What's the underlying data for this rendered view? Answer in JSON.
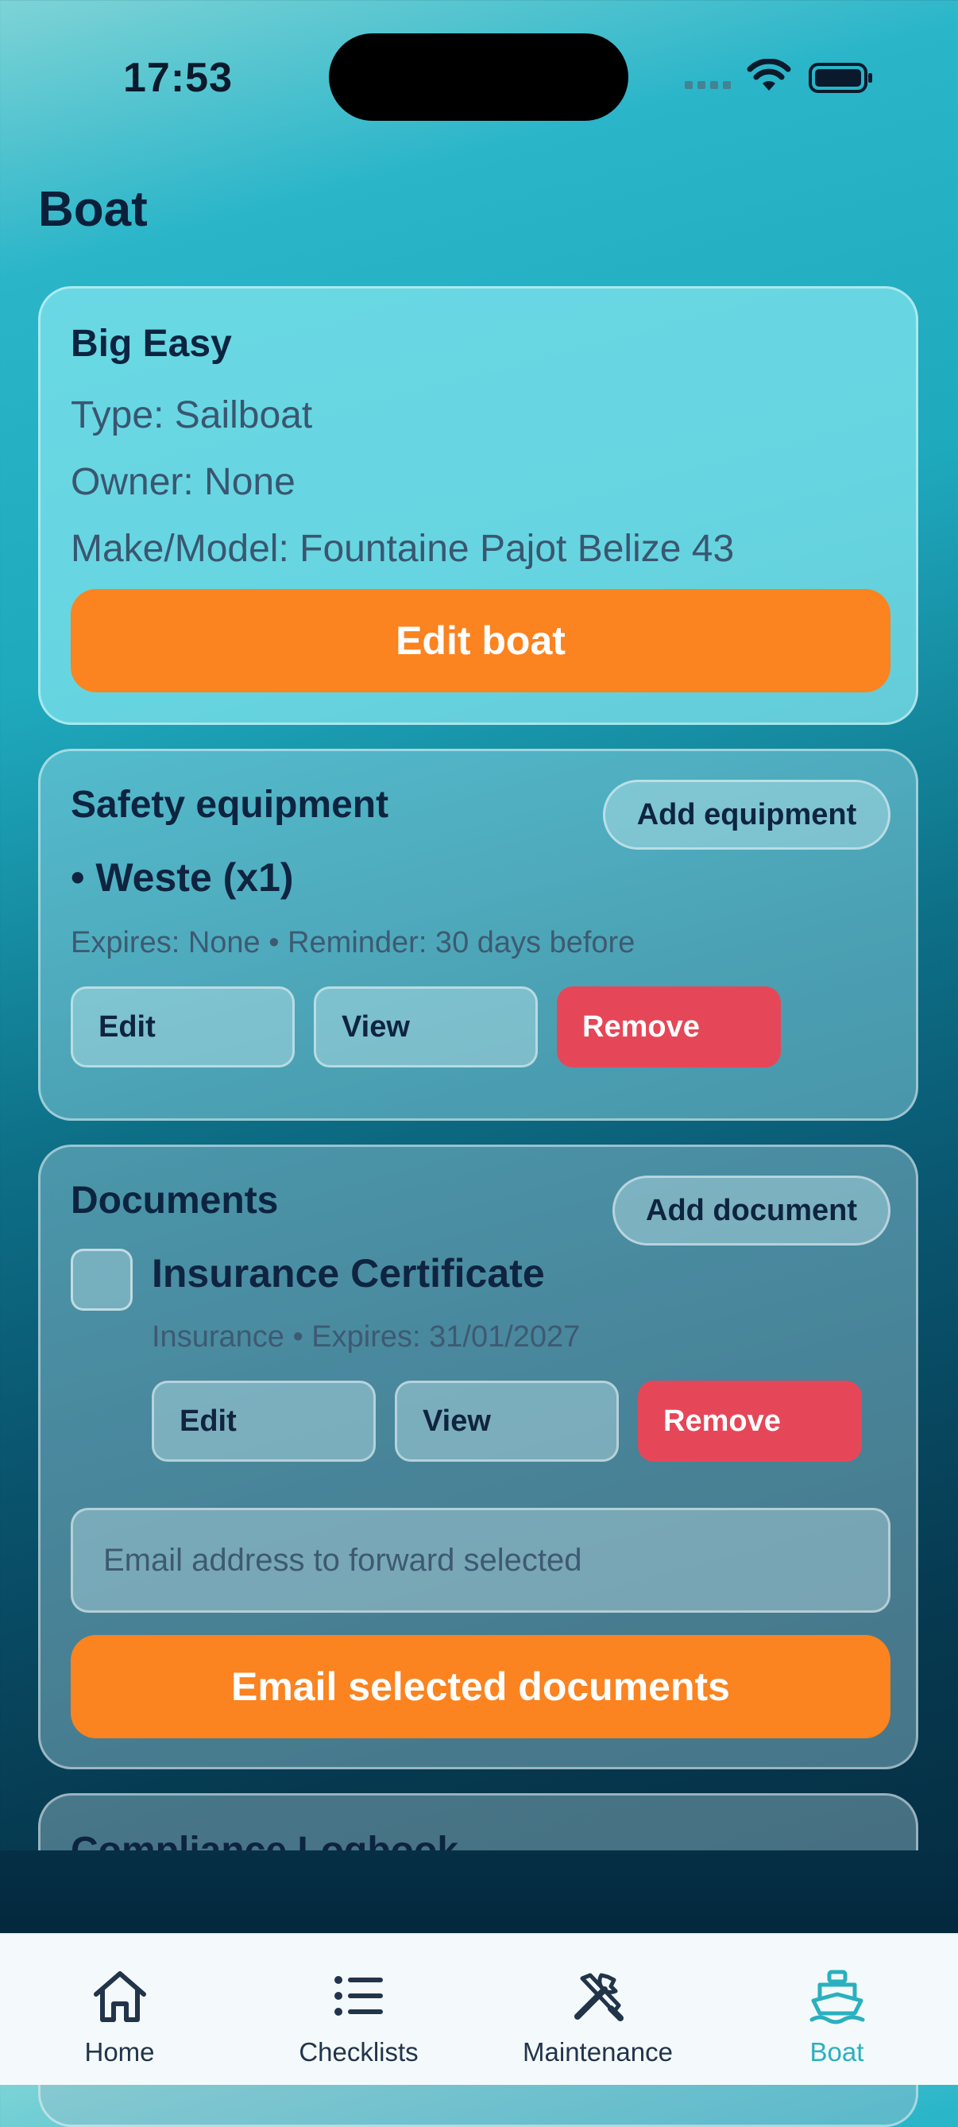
{
  "status": {
    "time": "17:53"
  },
  "page": {
    "title": "Boat"
  },
  "boat_card": {
    "name": "Big Easy",
    "type": "Type: Sailboat",
    "owner": "Owner: None",
    "make_model": "Make/Model: Fountaine Pajot Belize 43",
    "edit_label": "Edit boat"
  },
  "safety": {
    "title": "Safety equipment",
    "add_label": "Add equipment",
    "items": [
      {
        "name": "• Weste (x1)",
        "meta": "Expires: None • Reminder: 30 days before",
        "edit": "Edit",
        "view": "View",
        "remove": "Remove"
      }
    ]
  },
  "documents": {
    "title": "Documents",
    "add_label": "Add document",
    "items": [
      {
        "name": "Insurance Certificate",
        "meta": "Insurance • Expires: 31/01/2027",
        "edit": "Edit",
        "view": "View",
        "remove": "Remove"
      }
    ],
    "email_placeholder": "Email address to forward selected",
    "email_button": "Email selected documents"
  },
  "compliance": {
    "title": "Compliance Logbook"
  },
  "tabs": [
    {
      "label": "Home",
      "icon": "home-icon",
      "active": false
    },
    {
      "label": "Checklists",
      "icon": "list-icon",
      "active": false
    },
    {
      "label": "Maintenance",
      "icon": "tools-icon",
      "active": false
    },
    {
      "label": "Boat",
      "icon": "boat-icon",
      "active": true
    }
  ],
  "colors": {
    "accent": "#fb8320",
    "danger": "#e64758",
    "active_tab": "#2ab0bf"
  }
}
